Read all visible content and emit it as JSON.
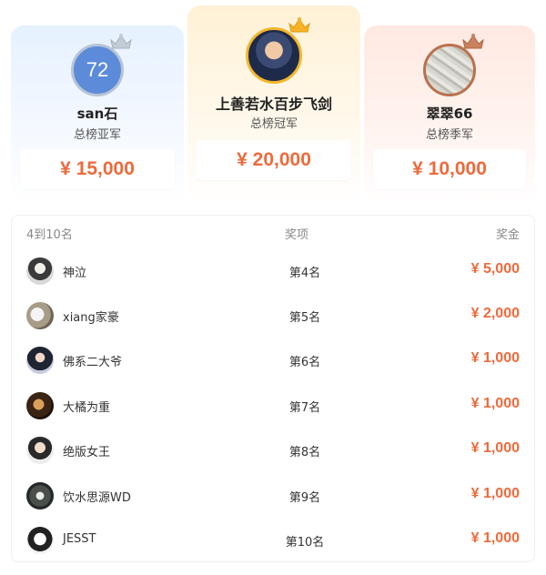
{
  "podium": {
    "second": {
      "avatar_text": "72",
      "name": "san石",
      "title": "总榜亚军",
      "prize": "¥ 15,000",
      "crown_color": "#c3cbd6"
    },
    "first": {
      "name": "上善若水百步飞剑",
      "title": "总榜冠军",
      "prize": "¥ 20,000",
      "crown_color": "#f6b327"
    },
    "third": {
      "name": "翠翠66",
      "title": "总榜季军",
      "prize": "¥ 10,000",
      "crown_color": "#c9825e"
    }
  },
  "list": {
    "headers": {
      "col1": "4到10名",
      "col2": "奖项",
      "col3": "奖金"
    },
    "rows": [
      {
        "name": "神泣",
        "rank": "第4名",
        "prize": "¥ 5,000"
      },
      {
        "name": "xiang家豪",
        "rank": "第5名",
        "prize": "¥ 2,000"
      },
      {
        "name": "佛系二大爷",
        "rank": "第6名",
        "prize": "¥ 1,000"
      },
      {
        "name": "大橘为重",
        "rank": "第7名",
        "prize": "¥ 1,000"
      },
      {
        "name": "绝版女王",
        "rank": "第8名",
        "prize": "¥ 1,000"
      },
      {
        "name": "饮水思源WD",
        "rank": "第9名",
        "prize": "¥ 1,000"
      },
      {
        "name": "JESST",
        "rank": "第10名",
        "prize": "¥ 1,000"
      }
    ]
  },
  "colors": {
    "prize_text": "#ee6a3b"
  }
}
